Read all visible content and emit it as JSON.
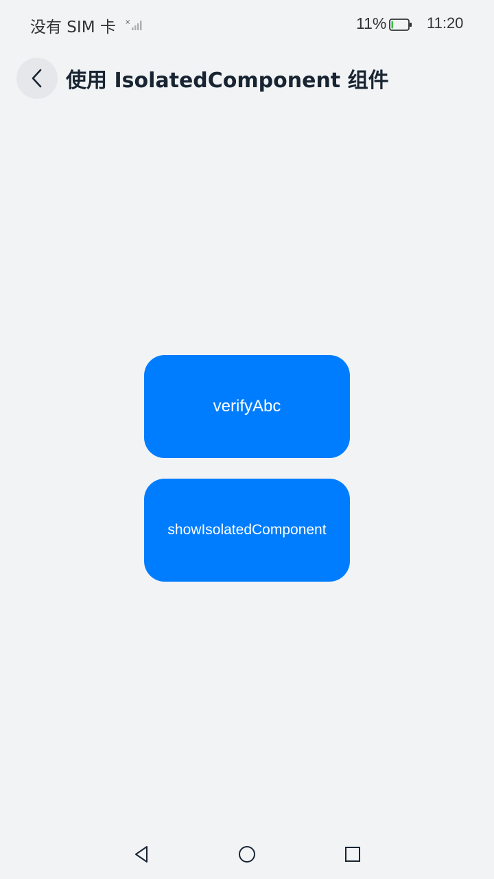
{
  "status_bar": {
    "carrier": "没有 SIM 卡",
    "signal_icon": "signal-no-sim-icon",
    "battery_percent": "11%",
    "battery_level": 0.11,
    "battery_icon": "battery-icon",
    "time": "11:20"
  },
  "title_bar": {
    "back_icon": "chevron-left-icon",
    "title": "使用 IsolatedComponent 组件"
  },
  "main": {
    "buttons": [
      {
        "label": "verifyAbc"
      },
      {
        "label": "showIsolatedComponent"
      }
    ],
    "button_color": "#007DFF",
    "background_color": "#F1F3F5"
  },
  "nav_bar": {
    "back_icon": "triangle-back-icon",
    "home_icon": "circle-home-icon",
    "recent_icon": "square-recent-icon"
  }
}
